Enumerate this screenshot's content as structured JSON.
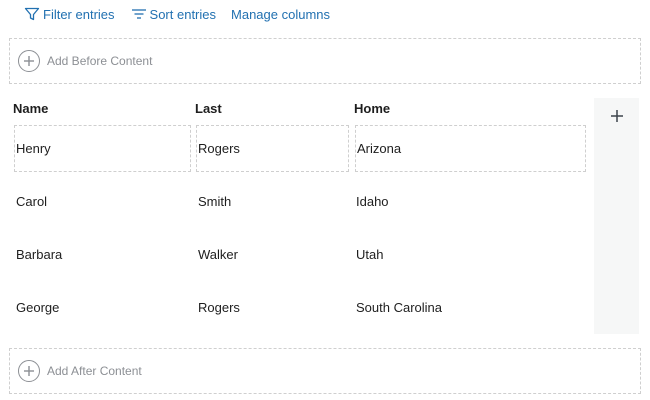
{
  "toolbar": {
    "filter_label": "Filter entries",
    "sort_label": "Sort entries",
    "manage_label": "Manage columns"
  },
  "add_before": {
    "label": "Add Before Content"
  },
  "add_after": {
    "label": "Add After Content"
  },
  "table": {
    "columns": [
      "Name",
      "Last",
      "Home"
    ],
    "rows": [
      [
        "Henry",
        "Rogers",
        "Arizona"
      ],
      [
        "Carol",
        "Smith",
        "Idaho"
      ],
      [
        "Barbara",
        "Walker",
        "Utah"
      ],
      [
        "George",
        "Rogers",
        "South Carolina"
      ]
    ]
  },
  "icons": {
    "filter": "filter-icon",
    "sort": "sort-icon",
    "add": "plus-circle-icon",
    "add_column": "plus-icon"
  },
  "colors": {
    "link": "#2271b1",
    "muted": "#8c8f94",
    "panel": "#f6f7f7",
    "border": "#cfcfcf"
  }
}
